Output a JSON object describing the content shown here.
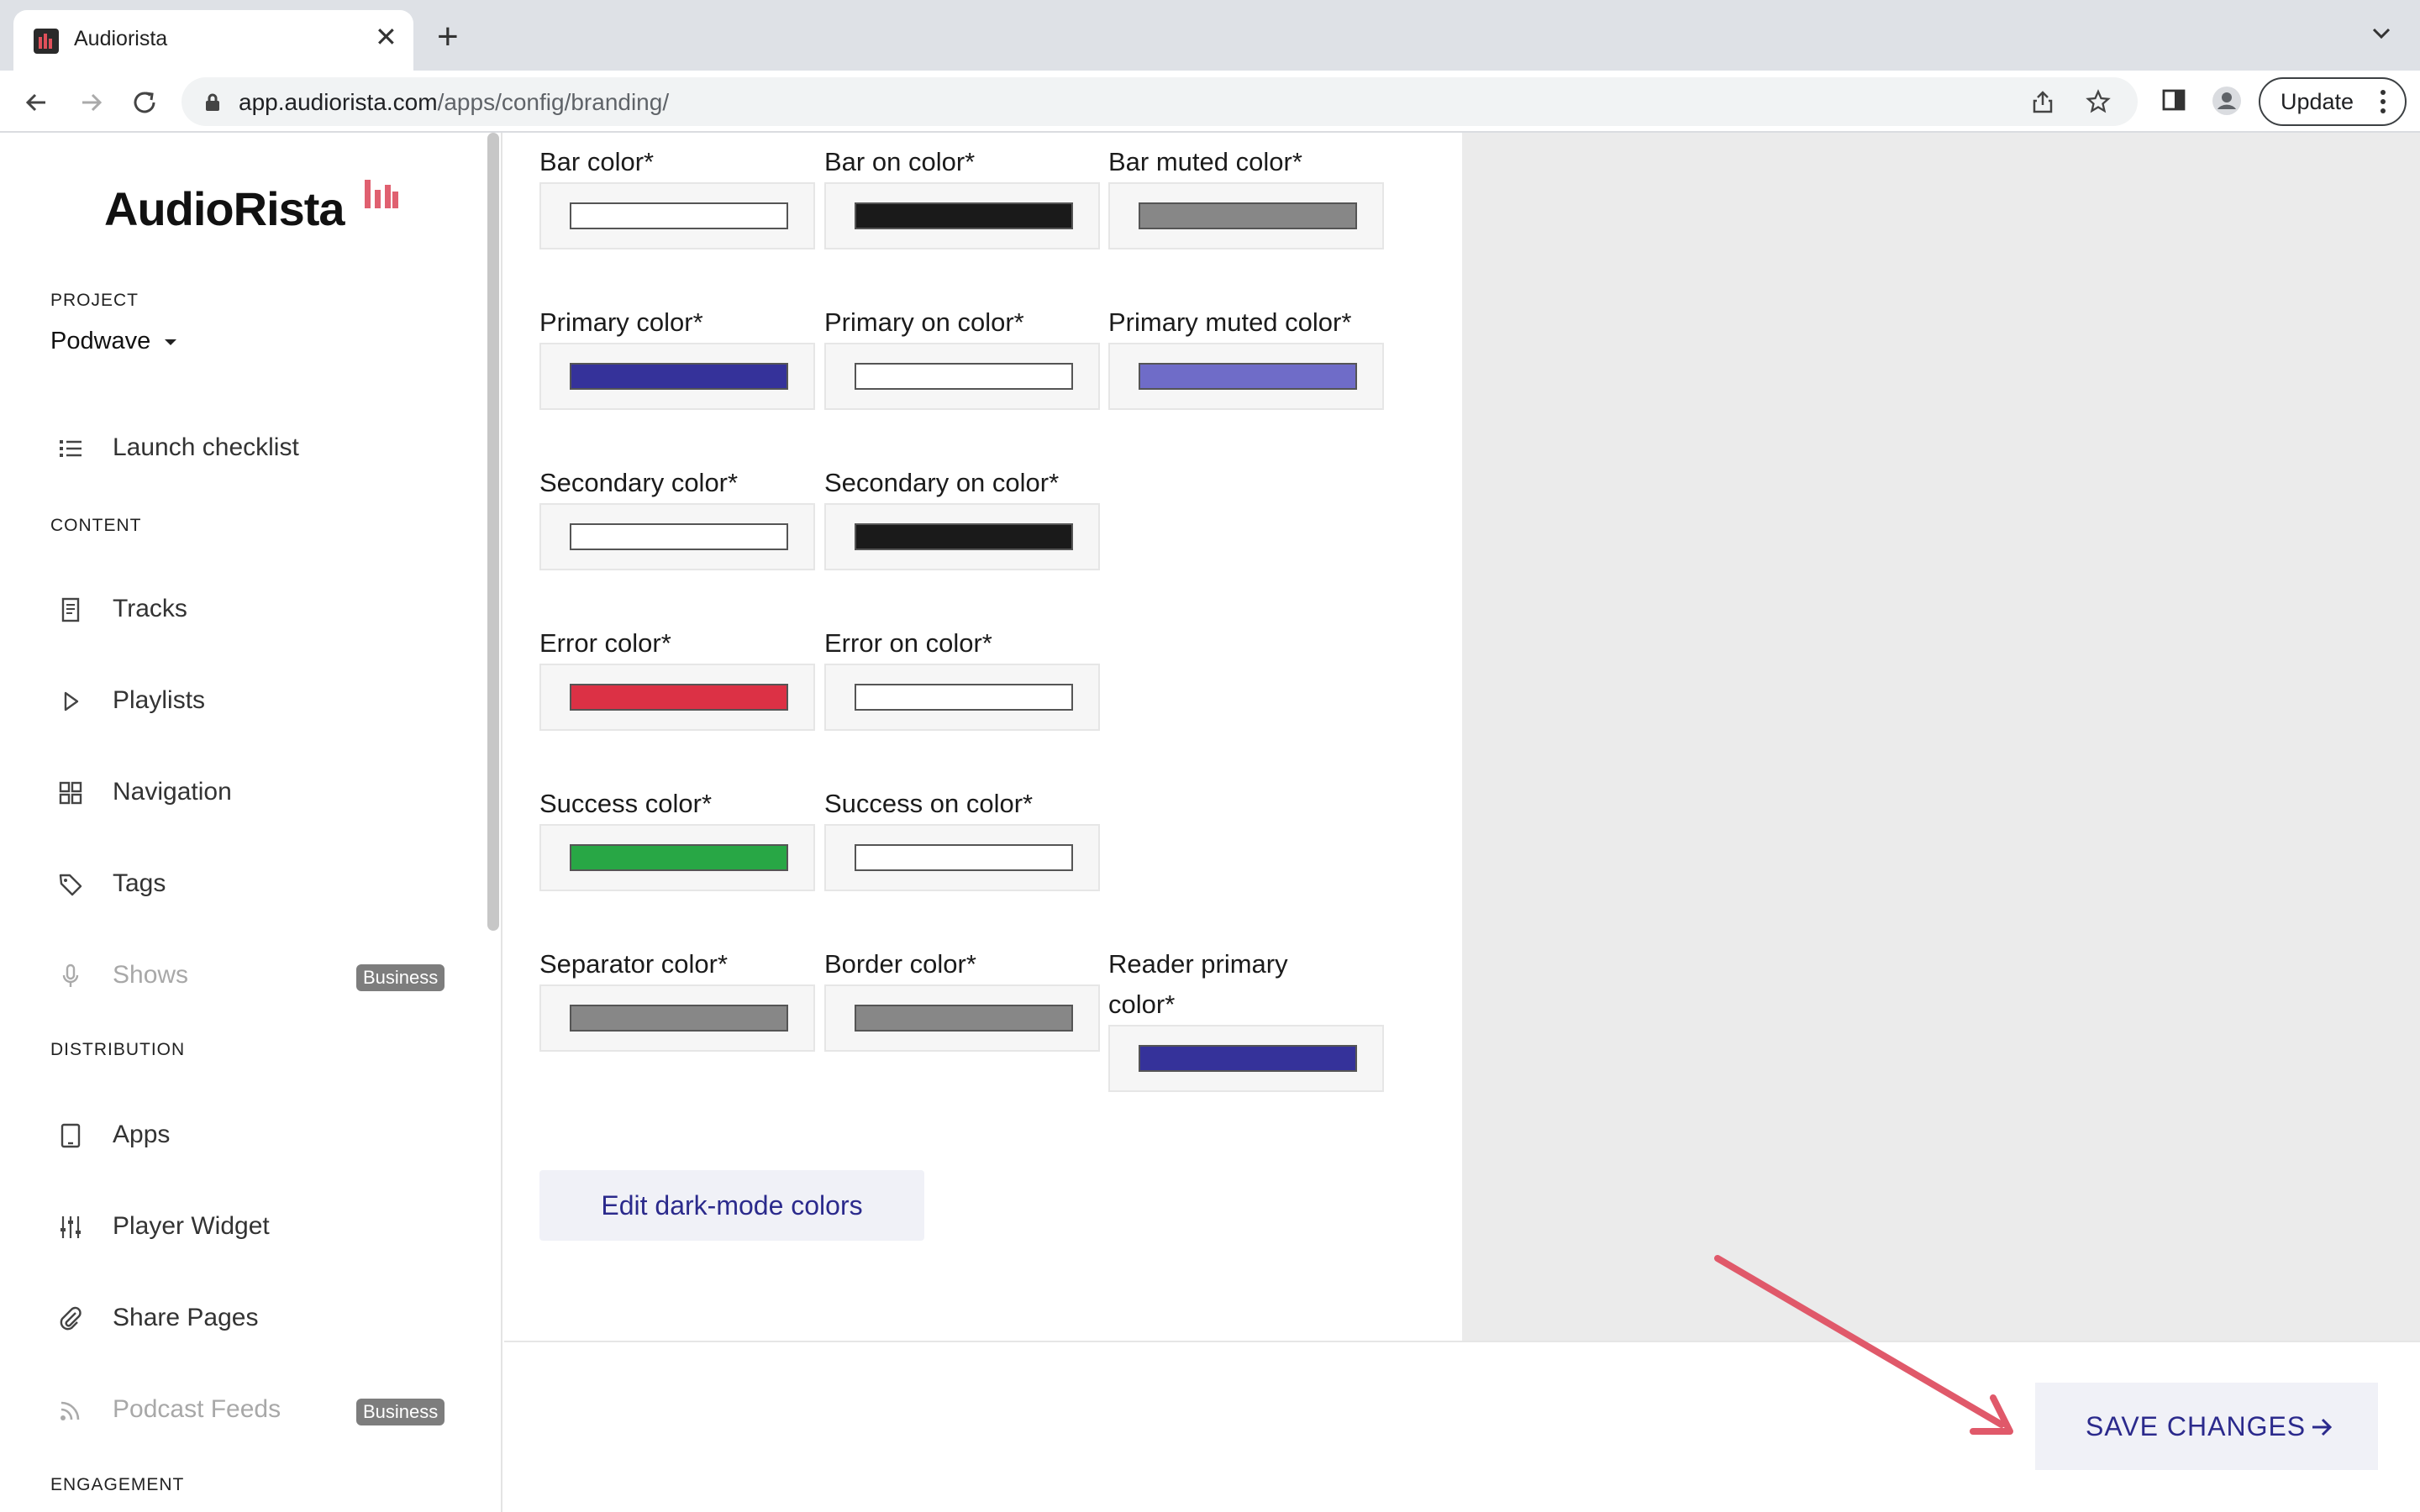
{
  "browser": {
    "tab_title": "Audiorista",
    "tab_close": "✕",
    "new_tab": "+",
    "url_host": "app.audiorista.com",
    "url_path": "/apps/config/branding/",
    "update_label": "Update"
  },
  "sidebar": {
    "logo_text": "AudioRista",
    "project_label": "PROJECT",
    "project_value": "Podwave",
    "launch_checklist": "Launch checklist",
    "content_label": "CONTENT",
    "content_items": [
      {
        "label": "Tracks",
        "icon": "document-icon"
      },
      {
        "label": "Playlists",
        "icon": "play-icon"
      },
      {
        "label": "Navigation",
        "icon": "grid-icon"
      },
      {
        "label": "Tags",
        "icon": "tag-icon"
      },
      {
        "label": "Shows",
        "icon": "microphone-icon",
        "badge": "Business",
        "disabled": true
      }
    ],
    "distribution_label": "DISTRIBUTION",
    "distribution_items": [
      {
        "label": "Apps",
        "icon": "tablet-icon"
      },
      {
        "label": "Player Widget",
        "icon": "sliders-icon"
      },
      {
        "label": "Share Pages",
        "icon": "paperclip-icon"
      },
      {
        "label": "Podcast Feeds",
        "icon": "rss-icon",
        "badge": "Business",
        "disabled": true
      }
    ],
    "engagement_label": "ENGAGEMENT"
  },
  "colors": {
    "bar": {
      "label": "Bar color*",
      "value": "#ffffff"
    },
    "bar_on": {
      "label": "Bar on color*",
      "value": "#1a1a1a"
    },
    "bar_muted": {
      "label": "Bar muted color*",
      "value": "#878787"
    },
    "primary": {
      "label": "Primary color*",
      "value": "#35329a"
    },
    "primary_on": {
      "label": "Primary on color*",
      "value": "#ffffff"
    },
    "primary_muted": {
      "label": "Primary muted color*",
      "value": "#6f6cc8"
    },
    "secondary": {
      "label": "Secondary color*",
      "value": "#ffffff"
    },
    "secondary_on": {
      "label": "Secondary on color*",
      "value": "#1a1a1a"
    },
    "error": {
      "label": "Error color*",
      "value": "#dc3145"
    },
    "error_on": {
      "label": "Error on color*",
      "value": "#ffffff"
    },
    "success": {
      "label": "Success color*",
      "value": "#28a745"
    },
    "success_on": {
      "label": "Success on color*",
      "value": "#ffffff"
    },
    "separator": {
      "label": "Separator color*",
      "value": "#878787"
    },
    "border": {
      "label": "Border color*",
      "value": "#878787"
    },
    "reader_primary": {
      "label": "Reader primary color*",
      "value": "#35329a"
    }
  },
  "actions": {
    "edit_dark_mode": "Edit dark-mode colors",
    "save_changes": "SAVE CHANGES"
  },
  "theme": {
    "accent": "#2b2a8c",
    "logo_accent": "#e06070",
    "annotation_arrow": "#e0596a"
  }
}
